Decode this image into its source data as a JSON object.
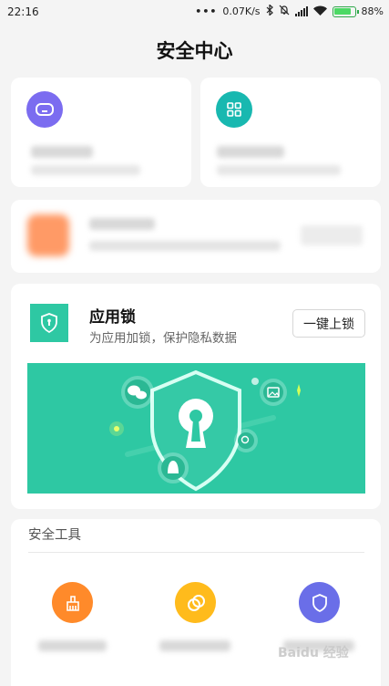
{
  "status_bar": {
    "time": "22:16",
    "speed": "0.07K/s",
    "battery": "88%",
    "battery_level": 0.88,
    "icons": [
      "bluetooth-icon",
      "mute-icon",
      "signal-icon",
      "wifi-icon",
      "battery-icon"
    ]
  },
  "header": {
    "title": "安全中心"
  },
  "top_cards": [
    {
      "icon": "gamepad-icon",
      "color": "#7b6cf0"
    },
    {
      "icon": "apps-grid-icon",
      "color": "#18b8b0"
    }
  ],
  "app_lock": {
    "title": "应用锁",
    "description": "为应用加锁，保护隐私数据",
    "button_label": "一键上锁",
    "icon": "shield-lock-icon",
    "accent": "#2ec8a3",
    "banner_icons": [
      "wechat-icon",
      "image-icon",
      "qq-icon",
      "search-icon",
      "keyhole-shield-icon"
    ]
  },
  "tools": {
    "title": "安全工具",
    "items": [
      {
        "icon": "clean-icon",
        "color": "#ff8a2a"
      },
      {
        "icon": "rings-icon",
        "color": "#ffbb1c"
      },
      {
        "icon": "shield-icon",
        "color": "#6a6ee8"
      }
    ]
  },
  "watermark": "Baidu 经验"
}
